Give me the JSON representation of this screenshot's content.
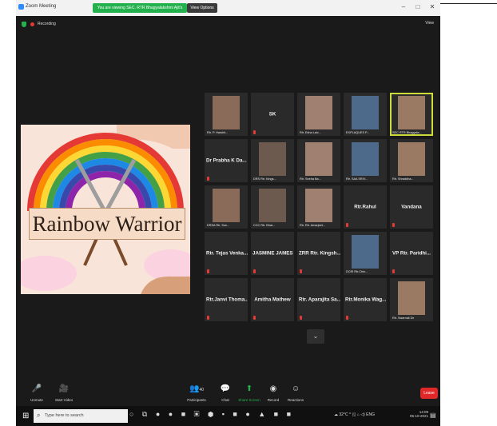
{
  "window": {
    "title": "Zoom Meeting",
    "viewing_banner": "You are viewing SEC. RTR Bhagyalakshmi Ajit's screen",
    "view_options_label": "View Options",
    "minimize": "–",
    "maximize": "□",
    "close": "✕"
  },
  "meeting": {
    "recording_label": "Recording",
    "view_label": "View",
    "shared_screen_text": "Rainbow Warrior",
    "colors": {
      "accent_green": "#23b14d",
      "leave_red": "#e02828",
      "highlight": "#cddc39"
    }
  },
  "participants": [
    {
      "name": "",
      "caption": "Rtr. P. Harshit..."
    },
    {
      "name": "SK",
      "caption": ""
    },
    {
      "name": "",
      "caption": "Rtr. Esha Lalc..."
    },
    {
      "name": "",
      "caption": "EXPLAQUES P..."
    },
    {
      "name": "",
      "caption": "SEC RTR Bhagyala..."
    },
    {
      "name": "Dr Prabha K Da...",
      "caption": ""
    },
    {
      "name": "",
      "caption": "DRS Rtr. Kings..."
    },
    {
      "name": "",
      "caption": "Rtr. Sneha Ba..."
    },
    {
      "name": "",
      "caption": "Rtr. SAA SRIV..."
    },
    {
      "name": "",
      "caption": "Rtr. Shraddha..."
    },
    {
      "name": "",
      "caption": "DRSA Rtr. Sun..."
    },
    {
      "name": "",
      "caption": "CCC Rtr. Bhar..."
    },
    {
      "name": "",
      "caption": "Rtr. Rtr. Amarjeet..."
    },
    {
      "name": "Rtr.Rahul",
      "caption": ""
    },
    {
      "name": "Vandana",
      "caption": ""
    },
    {
      "name": "Rtr. Tejas Venka...",
      "caption": ""
    },
    {
      "name": "JASMINE JAMES",
      "caption": ""
    },
    {
      "name": "ZRR Rtr. Kingsh...",
      "caption": ""
    },
    {
      "name": "",
      "caption": "DCIR Rtr.Chin..."
    },
    {
      "name": "VP Rtr. Paridhi...",
      "caption": ""
    },
    {
      "name": "Rtr.Janvi Thoma...",
      "caption": ""
    },
    {
      "name": "Amitha Mathew",
      "caption": ""
    },
    {
      "name": "Rtr. Aparajita Sa...",
      "caption": ""
    },
    {
      "name": "Rtr.Monika Wag...",
      "caption": ""
    },
    {
      "name": "",
      "caption": "Rtr. Swarnali De"
    }
  ],
  "gallery_next_label": "⌄",
  "toolbar": {
    "unmute": "Unmute",
    "start_video": "Start Video",
    "participants": "Participants",
    "participants_count": "40",
    "chat": "Chat",
    "share_screen": "Share Screen",
    "record": "Record",
    "reactions": "Reactions",
    "leave": "Leave"
  },
  "taskbar": {
    "search_placeholder": "Type here to search",
    "temperature": "32°C",
    "language": "ENG",
    "time": "14:09",
    "date": "05-10-2021"
  }
}
